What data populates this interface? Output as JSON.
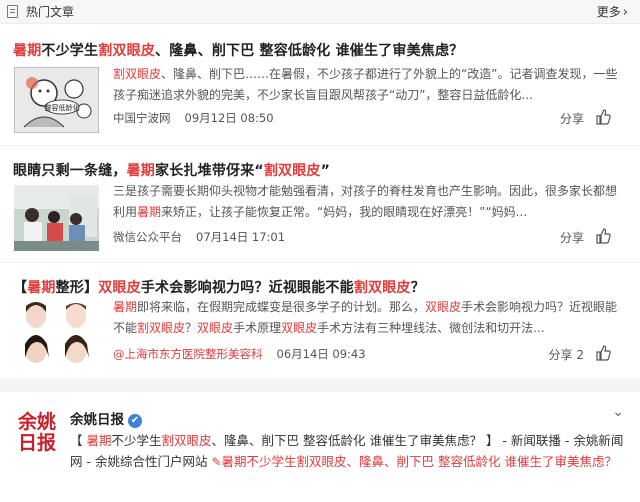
{
  "header": {
    "title": "热门文章",
    "more": "更多",
    "more_chevron": "›"
  },
  "articles": [
    {
      "headline_parts": [
        {
          "t": "暑期",
          "hl": true
        },
        {
          "t": "不少学生",
          "hl": false
        },
        {
          "t": "割双眼皮",
          "hl": true
        },
        {
          "t": "、隆鼻、削下巴 整容低龄化 谁催生了审美焦虑？",
          "hl": false
        }
      ],
      "snippet_parts": [
        {
          "t": "割双眼皮",
          "hl": true
        },
        {
          "t": "、隆鼻、削下巴……在暑假，不少孩子都进行了外貌上的“改造”。记者调查发现，一些孩子痴迷追求外貌的完美，不少家长盲目跟风帮孩子“动刀”，整容日益低龄化...",
          "hl": false
        }
      ],
      "source": "中国宁波网",
      "time": "09月12日 08:50",
      "share": "分享",
      "thumb_label": "整容低龄化"
    },
    {
      "headline_parts": [
        {
          "t": "眼睛只剩一条缝，",
          "hl": false
        },
        {
          "t": "暑期",
          "hl": true
        },
        {
          "t": "家长扎堆带伢来“",
          "hl": false
        },
        {
          "t": "割双眼皮",
          "hl": true
        },
        {
          "t": "”",
          "hl": false
        }
      ],
      "snippet_parts": [
        {
          "t": "三是孩子需要长期仰头视物才能勉强看清，对孩子的脊柱发育也产生影响。因此，很多家长都想利用",
          "hl": false
        },
        {
          "t": "暑期",
          "hl": true
        },
        {
          "t": "来矫正，让孩子能恢复正常。“妈妈，我的眼睛现在好漂亮！”“妈妈...",
          "hl": false
        }
      ],
      "source": "微信公众平台",
      "time": "07月14日 17:01",
      "share": "分享"
    },
    {
      "headline_parts": [
        {
          "t": "【",
          "hl": false
        },
        {
          "t": "暑期",
          "hl": true
        },
        {
          "t": "整形】",
          "hl": false
        },
        {
          "t": "双眼皮",
          "hl": true
        },
        {
          "t": "手术会影响视力吗？近视眼能不能",
          "hl": false
        },
        {
          "t": "割双眼皮",
          "hl": true
        },
        {
          "t": "？",
          "hl": false
        }
      ],
      "snippet_parts": [
        {
          "t": "暑期",
          "hl": true
        },
        {
          "t": "即将来临，在假期完成蝶变是很多学子的计划。那么，",
          "hl": false
        },
        {
          "t": "双眼皮",
          "hl": true
        },
        {
          "t": "手术会影响视力吗？近视眼能不能",
          "hl": false
        },
        {
          "t": "割双眼皮",
          "hl": true
        },
        {
          "t": "？",
          "hl": false
        },
        {
          "t": "双眼皮",
          "hl": true
        },
        {
          "t": "手术原理",
          "hl": false
        },
        {
          "t": "双眼皮",
          "hl": true
        },
        {
          "t": "手术方法有三种埋线法、微创法和切开法...",
          "hl": false
        }
      ],
      "source": "@上海市东方医院整形美容科",
      "time": "06月14日 09:43",
      "share": "分享 2"
    }
  ],
  "source_card": {
    "name": "余姚日报",
    "logo_text": "余姚日报",
    "verified": "✔",
    "collapse": "⌄",
    "body_parts": [
      {
        "t": "【 ",
        "hl": false
      },
      {
        "t": "暑期",
        "hl": true
      },
      {
        "t": "不少学生",
        "hl": false
      },
      {
        "t": "割双眼皮",
        "hl": true
      },
      {
        "t": "、隆鼻、削下巴 整容低龄化 谁催生了审美焦虑？ 】 - 新闻联播 - 余姚新闻网 - 余姚综合性门户网站 ",
        "hl": false
      }
    ],
    "link_text": "暑期不少学生割双眼皮、隆鼻、削下巴 整容低龄化 谁催生了审美焦虑？"
  }
}
